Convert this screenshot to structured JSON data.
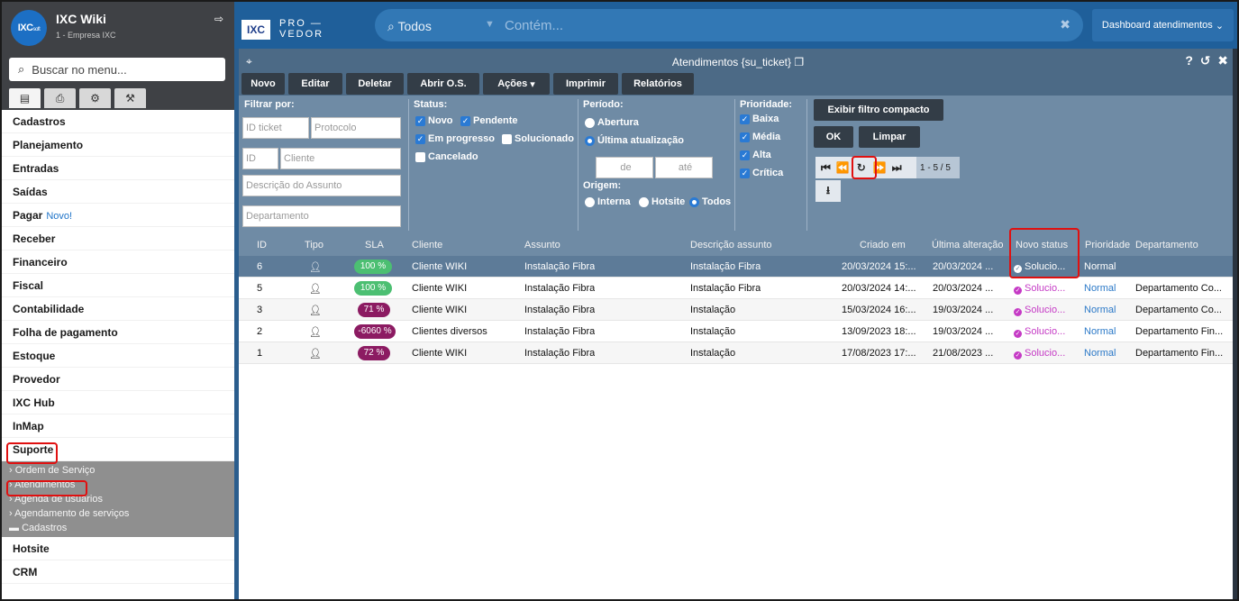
{
  "sidebar": {
    "logo": "IXC",
    "logo_suffix": "soft",
    "title": "IXC Wiki",
    "subtitle": "1 - Empresa IXC",
    "search_placeholder": "Buscar no menu...",
    "menu": [
      {
        "label": "Cadastros"
      },
      {
        "label": "Planejamento"
      },
      {
        "label": "Entradas"
      },
      {
        "label": "Saídas"
      },
      {
        "label": "Pagar",
        "badge": "Novo!"
      },
      {
        "label": "Receber"
      },
      {
        "label": "Financeiro"
      },
      {
        "label": "Fiscal"
      },
      {
        "label": "Contabilidade"
      },
      {
        "label": "Folha de pagamento"
      },
      {
        "label": "Estoque"
      },
      {
        "label": "Provedor"
      },
      {
        "label": "IXC Hub"
      },
      {
        "label": "InMap"
      },
      {
        "label": "Suporte"
      }
    ],
    "suporte_sub": [
      "Ordem de Serviço",
      "Atendimentos",
      "Agenda de usuários",
      "Agendamento de serviços",
      "Cadastros"
    ],
    "menu_after": [
      {
        "label": "Hotsite"
      },
      {
        "label": "CRM"
      }
    ]
  },
  "topbar": {
    "logo": "IXC",
    "brand_line1": "PRO —",
    "brand_line2": "VEDOR",
    "search_scope": "Todos",
    "search_placeholder": "Contém...",
    "dashboard": "Dashboard atendimentos"
  },
  "window": {
    "title": "Atendimentos {su_ticket}",
    "buttons": [
      "Novo",
      "Editar",
      "Deletar",
      "Abrir O.S.",
      "Ações",
      "Imprimir",
      "Relatórios"
    ]
  },
  "filter": {
    "label": "Filtrar por:",
    "id_ticket": "ID ticket",
    "protocolo": "Protocolo",
    "id": "ID",
    "cliente": "Cliente",
    "descricao": "Descrição do Assunto",
    "departamento": "Departamento",
    "status_label": "Status:",
    "status_novo": "Novo",
    "status_pendente": "Pendente",
    "status_progresso": "Em progresso",
    "status_solucionado": "Solucionado",
    "status_cancelado": "Cancelado",
    "periodo_label": "Período:",
    "periodo_abertura": "Abertura",
    "periodo_ultima": "Última atualização",
    "de": "de",
    "ate": "até",
    "origem_label": "Origem:",
    "origem_interna": "Interna",
    "origem_hotsite": "Hotsite",
    "origem_todos": "Todos",
    "prioridade_label": "Prioridade:",
    "prio_baixa": "Baixa",
    "prio_media": "Média",
    "prio_alta": "Alta",
    "prio_critica": "Crítica",
    "compact": "Exibir filtro compacto",
    "ok": "OK",
    "limpar": "Limpar",
    "page_info": "1 - 5 / 5"
  },
  "table": {
    "headers": [
      "ID",
      "Tipo",
      "SLA",
      "Cliente",
      "Assunto",
      "Descrição assunto",
      "Criado em",
      "Última alteração",
      "Novo status",
      "Prioridade",
      "Departamento"
    ],
    "rows": [
      {
        "id": "6",
        "sla": "100 %",
        "sla_color": "#4cbf72",
        "cliente": "Cliente WIKI",
        "assunto": "Instalação Fibra",
        "descricao": "Instalação Fibra",
        "criado": "20/03/2024 15:...",
        "alterado": "20/03/2024 ...",
        "status": "Solucio...",
        "prioridade": "Normal",
        "departamento": ""
      },
      {
        "id": "5",
        "sla": "100 %",
        "sla_color": "#4cbf72",
        "cliente": "Cliente WIKI",
        "assunto": "Instalação Fibra",
        "descricao": "Instalação Fibra",
        "criado": "20/03/2024 14:...",
        "alterado": "20/03/2024 ...",
        "status": "Solucio...",
        "prioridade": "Normal",
        "departamento": "Departamento Co..."
      },
      {
        "id": "3",
        "sla": "71 %",
        "sla_color": "#8c1b62",
        "cliente": "Cliente WIKI",
        "assunto": "Instalação Fibra",
        "descricao": "Instalação",
        "criado": "15/03/2024 16:...",
        "alterado": "19/03/2024 ...",
        "status": "Solucio...",
        "prioridade": "Normal",
        "departamento": "Departamento Co..."
      },
      {
        "id": "2",
        "sla": "-6060 %",
        "sla_color": "#8c1b62",
        "cliente": "Clientes diversos",
        "assunto": "Instalação Fibra",
        "descricao": "Instalação",
        "criado": "13/09/2023 18:...",
        "alterado": "19/03/2024 ...",
        "status": "Solucio...",
        "prioridade": "Normal",
        "departamento": "Departamento Fin..."
      },
      {
        "id": "1",
        "sla": "72 %",
        "sla_color": "#8c1b62",
        "cliente": "Cliente WIKI",
        "assunto": "Instalação Fibra",
        "descricao": "Instalação",
        "criado": "17/08/2023 17:...",
        "alterado": "21/08/2023 ...",
        "status": "Solucio...",
        "prioridade": "Normal",
        "departamento": "Departamento Fin..."
      }
    ]
  }
}
